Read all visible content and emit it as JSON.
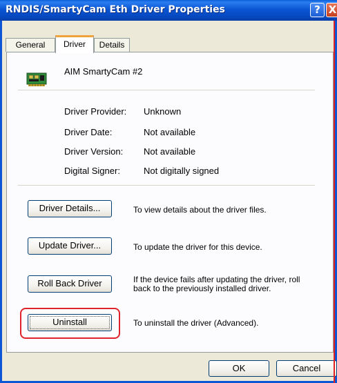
{
  "window": {
    "title": "RNDIS/SmartyCam Eth Driver Properties",
    "help_glyph": "?",
    "close_glyph": "X"
  },
  "tabs": [
    {
      "label": "General",
      "selected": false
    },
    {
      "label": "Driver",
      "selected": true
    },
    {
      "label": "Details",
      "selected": false
    }
  ],
  "device": {
    "icon": "network-adapter-icon",
    "name": "AIM SmartyCam #2"
  },
  "properties": [
    {
      "label": "Driver Provider:",
      "value": "Unknown"
    },
    {
      "label": "Driver Date:",
      "value": "Not available"
    },
    {
      "label": "Driver Version:",
      "value": "Not available"
    },
    {
      "label": "Digital Signer:",
      "value": "Not digitally signed"
    }
  ],
  "actions": [
    {
      "button": "Driver Details...",
      "description": "To view details about the driver files."
    },
    {
      "button": "Update Driver...",
      "description": "To update the driver for this device."
    },
    {
      "button": "Roll Back Driver",
      "description": "If the device fails after updating the driver, roll back to the previously installed driver."
    },
    {
      "button": "Uninstall",
      "description": "To uninstall the driver (Advanced)."
    }
  ],
  "dialog_buttons": {
    "ok": "OK",
    "cancel": "Cancel"
  },
  "colors": {
    "titlebar": "#0b56d4",
    "highlight": "#e0232b",
    "tab_accent": "#f2a23a"
  }
}
